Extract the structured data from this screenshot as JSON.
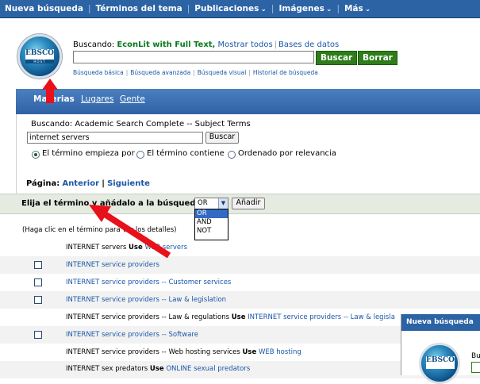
{
  "topnav": {
    "items": [
      {
        "label": "Nueva búsqueda",
        "dropdown": false
      },
      {
        "label": "Términos del tema",
        "dropdown": false
      },
      {
        "label": "Publicaciones",
        "dropdown": true
      },
      {
        "label": "Imágenes",
        "dropdown": true
      },
      {
        "label": "Más",
        "dropdown": true
      }
    ]
  },
  "header": {
    "logo_text": "EBSCO",
    "logo_sub": "HOST",
    "searching_label": "Buscando:",
    "database": "EconLit with Full Text,",
    "show_all": "Mostrar todos",
    "databases": "Bases de datos",
    "search_value": "",
    "search_button": "Buscar",
    "clear_button": "Borrar",
    "links": [
      "Búsqueda básica",
      "Búsqueda avanzada",
      "Búsqueda visual",
      "Historial de búsqueda"
    ]
  },
  "panel": {
    "tabs": [
      "Materias",
      "Lugares",
      "Gente"
    ],
    "searching_in": "Buscando: Academic Search Complete -- Subject Terms",
    "term_value": "internet servers",
    "term_button": "Buscar",
    "radio_options": [
      {
        "label": "El término empieza por",
        "checked": true
      },
      {
        "label": "El término contiene",
        "checked": false
      },
      {
        "label": "Ordenado por relevancia",
        "checked": false
      }
    ],
    "page_label": "Página:",
    "prev": "Anterior",
    "next": "Siguiente",
    "choose_label": "Elija el término y añádalo a la búsqueda con:",
    "operator_selected": "OR",
    "operator_options": [
      "OR",
      "AND",
      "NOT"
    ],
    "add_button": "Añadir",
    "hint": "(Haga clic en el término para ver los detalles)"
  },
  "terms": [
    {
      "checkbox": false,
      "text": "INTERNET servers",
      "use": "Use",
      "link": "WEB servers"
    },
    {
      "checkbox": true,
      "text": "INTERNET service providers",
      "use": "",
      "link": ""
    },
    {
      "checkbox": true,
      "text": "INTERNET service providers -- Customer services",
      "use": "",
      "link": ""
    },
    {
      "checkbox": true,
      "text": "INTERNET service providers -- Law & legislation",
      "use": "",
      "link": ""
    },
    {
      "checkbox": false,
      "text": "INTERNET service providers -- Law & regulations",
      "use": "Use",
      "link": "INTERNET service providers -- Law & legisla"
    },
    {
      "checkbox": true,
      "text": "INTERNET service providers -- Software",
      "use": "",
      "link": ""
    },
    {
      "checkbox": false,
      "text": "INTERNET service providers -- Web hosting services",
      "use": "Use",
      "link": "WEB hosting"
    },
    {
      "checkbox": false,
      "text": "INTERNET sex predators",
      "use": "Use",
      "link": "ONLINE sexual predators"
    }
  ],
  "overlay": {
    "nav_label": "Nueva búsqueda",
    "logo_text": "EBSCO",
    "partial_text": "Bu"
  },
  "colors": {
    "nav_blue": "#2c63a4",
    "button_green": "#2e7d1a",
    "link_blue": "#1a56a8",
    "arrow_red": "#e8101a"
  }
}
